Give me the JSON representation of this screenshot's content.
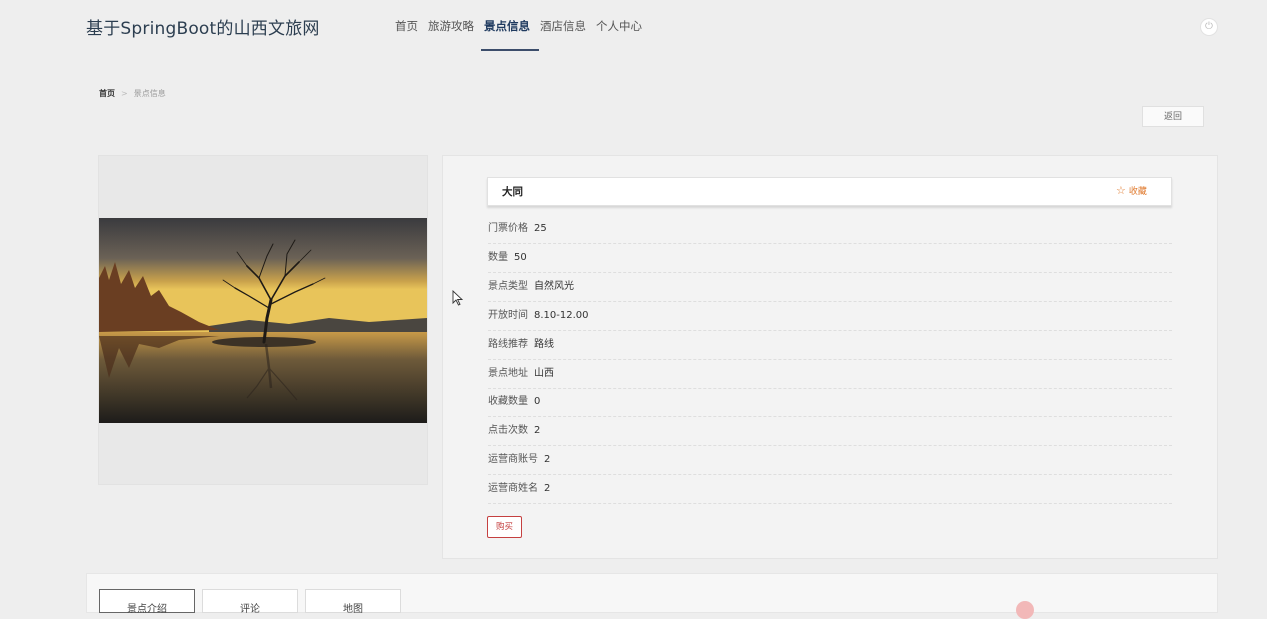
{
  "header": {
    "title": "基于SpringBoot的山西文旅网",
    "nav": [
      "首页",
      "旅游攻略",
      "景点信息",
      "酒店信息",
      "个人中心"
    ],
    "active_nav": "景点信息",
    "logout_icon": "power-icon"
  },
  "breadcrumb": {
    "home": "首页",
    "separator": ">",
    "current": "景点信息"
  },
  "back_label": "返回",
  "detail": {
    "name": "大同",
    "favorite_label": "收藏",
    "favorite_icon": "☆",
    "fields": [
      {
        "label": "门票价格",
        "value": "25"
      },
      {
        "label": "数量",
        "value": "50"
      },
      {
        "label": "景点类型",
        "value": "自然风光"
      },
      {
        "label": "开放时间",
        "value": "8.10-12.00"
      },
      {
        "label": "路线推荐",
        "value": "路线"
      },
      {
        "label": "景点地址",
        "value": "山西"
      },
      {
        "label": "收藏数量",
        "value": "0"
      },
      {
        "label": "点击次数",
        "value": "2"
      },
      {
        "label": "运营商账号",
        "value": "2"
      },
      {
        "label": "运营商姓名",
        "value": "2"
      }
    ],
    "buy_label": "购买"
  },
  "tabs": [
    "景点介绍",
    "评论",
    "地图"
  ],
  "colors": {
    "accent": "#1f3a5f",
    "favorite": "#e07a2e",
    "buy": "#c54040"
  }
}
